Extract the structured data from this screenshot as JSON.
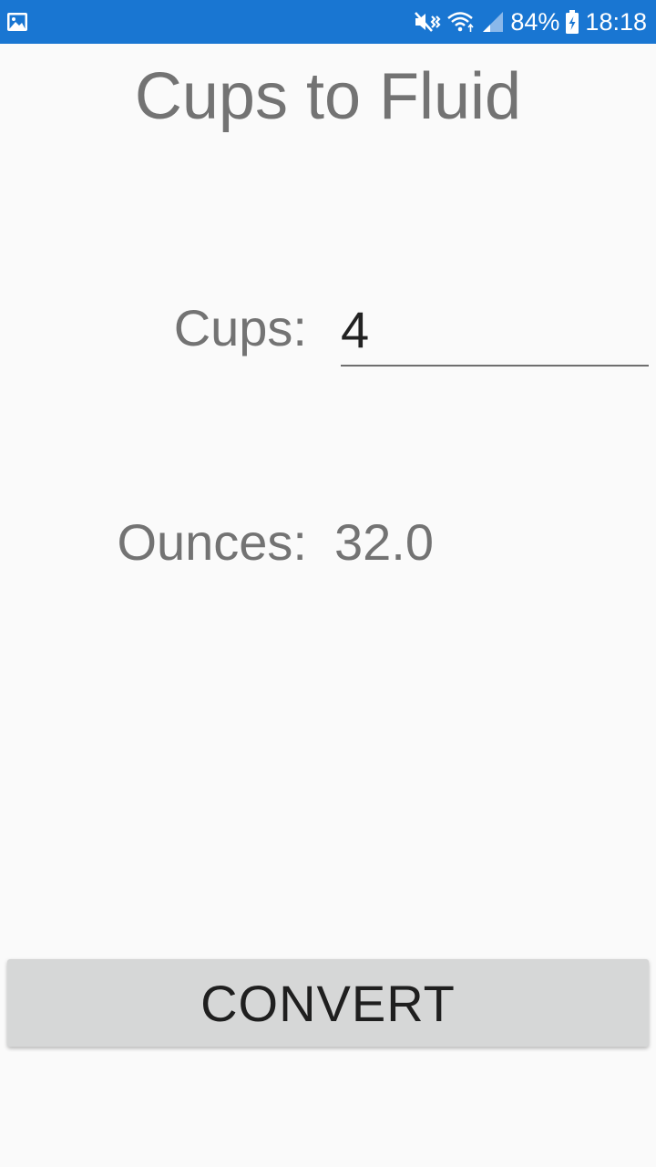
{
  "status_bar": {
    "battery_percent": "84%",
    "time": "18:18",
    "background_color": "#1976d2",
    "icons": [
      "image-notification-icon",
      "mute-vibrate-icon",
      "wifi-icon",
      "signal-icon",
      "battery-charging-icon"
    ]
  },
  "app": {
    "title": "Cups to Fluid"
  },
  "form": {
    "cups_label": "Cups:",
    "cups_value": "4",
    "ounces_label": "Ounces:",
    "ounces_value": "32.0"
  },
  "actions": {
    "convert_label": "CONVERT"
  }
}
